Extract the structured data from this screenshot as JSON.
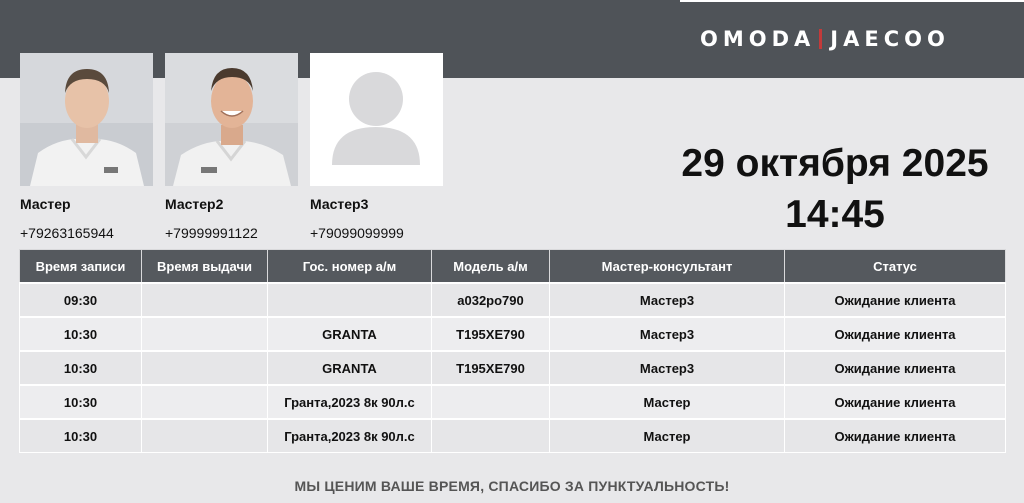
{
  "brand": {
    "logo_left": "OMODA",
    "logo_right": "JAECOO",
    "accent": "#c23a3a",
    "header_bg": "#4f5358"
  },
  "masters": [
    {
      "name": "Мастер",
      "phone": "+79263165944",
      "photo": "man-photo"
    },
    {
      "name": "Мастер2",
      "phone": "+79999991122",
      "photo": "man-photo"
    },
    {
      "name": "Мастер3",
      "phone": "+79099099999",
      "photo": "placeholder-avatar"
    }
  ],
  "datetime": {
    "date": "29 октября 2025",
    "time": "14:45"
  },
  "table": {
    "headers": [
      "Время записи",
      "Время выдачи",
      "Гос. номер а/м",
      "Модель а/м",
      "Мастер-консультант",
      "Статус"
    ],
    "rows": [
      [
        "09:30",
        "",
        "",
        "а032ро790",
        "Мастер3",
        "Ожидание клиента"
      ],
      [
        "10:30",
        "",
        "GRANTA",
        "Т195ХЕ790",
        "Мастер3",
        "Ожидание клиента"
      ],
      [
        "10:30",
        "",
        "GRANTA",
        "Т195ХЕ790",
        "Мастер3",
        "Ожидание клиента"
      ],
      [
        "10:30",
        "",
        "Гранта,2023 8к 90л.с",
        "",
        "Мастер",
        "Ожидание клиента"
      ],
      [
        "10:30",
        "",
        "Гранта,2023 8к 90л.с",
        "",
        "Мастер",
        "Ожидание клиента"
      ]
    ]
  },
  "footer": {
    "text": "МЫ ЦЕНИМ ВАШЕ ВРЕМЯ, СПАСИБО ЗА ПУНКТУАЛЬНОСТЬ!"
  }
}
